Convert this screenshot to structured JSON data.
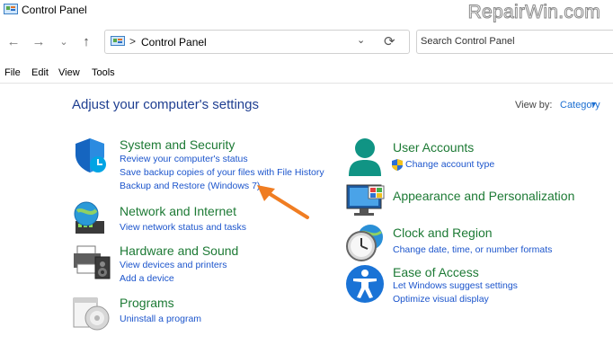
{
  "window": {
    "title": "Control Panel",
    "watermark": "RepairWin.com"
  },
  "nav": {
    "back": "←",
    "forward": "→",
    "recent": "⌄",
    "up": "↑",
    "address_sep": ">",
    "address_text": "Control Panel",
    "dropdown": "⌄",
    "refresh": "⟳"
  },
  "search": {
    "placeholder": "Search Control Panel"
  },
  "menu": {
    "file": "File",
    "edit": "Edit",
    "view": "View",
    "tools": "Tools"
  },
  "main": {
    "heading": "Adjust your computer's settings",
    "view_by_label": "View by:",
    "view_by_value": "Category",
    "view_by_arrow": "▼"
  },
  "left_categories": [
    {
      "title": "System and Security",
      "icon": "security-shield-icon",
      "links": [
        "Review your computer's status",
        "Save backup copies of your files with File History",
        "Backup and Restore (Windows 7)"
      ]
    },
    {
      "title": "Network and Internet",
      "icon": "network-globe-icon",
      "links": [
        "View network status and tasks"
      ]
    },
    {
      "title": "Hardware and Sound",
      "icon": "printer-speaker-icon",
      "links": [
        "View devices and printers",
        "Add a device"
      ]
    },
    {
      "title": "Programs",
      "icon": "programs-disc-icon",
      "links": [
        "Uninstall a program"
      ]
    }
  ],
  "right_categories": [
    {
      "title": "User Accounts",
      "icon": "user-accounts-icon",
      "links": [
        "Change account type"
      ]
    },
    {
      "title": "Appearance and Personalization",
      "icon": "appearance-monitor-icon",
      "links": []
    },
    {
      "title": "Clock and Region",
      "icon": "clock-globe-icon",
      "links": [
        "Change date, time, or number formats"
      ]
    },
    {
      "title": "Ease of Access",
      "icon": "ease-of-access-icon",
      "links": [
        "Let Windows suggest settings",
        "Optimize visual display"
      ]
    }
  ],
  "colors": {
    "heading": "#1f3f91",
    "category_title": "#1d7a35",
    "link": "#1c55cc",
    "annotation_arrow": "#f07d22"
  }
}
